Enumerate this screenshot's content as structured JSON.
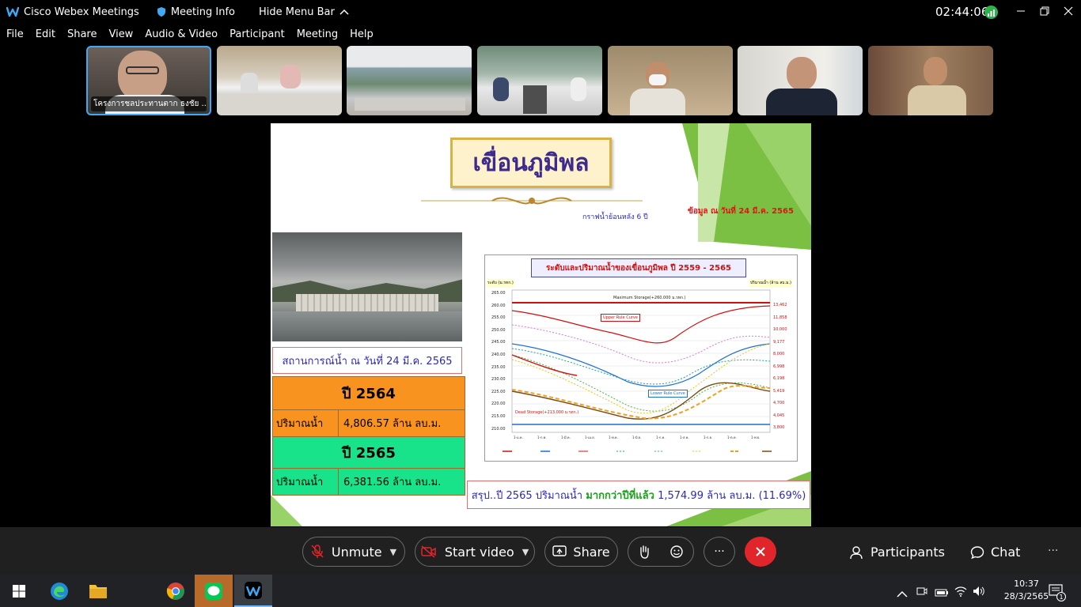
{
  "titlebar": {
    "app_name": "Cisco Webex Meetings",
    "meeting_info": "Meeting Info",
    "hide_menu": "Hide Menu Bar",
    "timer": "02:44:06"
  },
  "menu": [
    "File",
    "Edit",
    "Share",
    "View",
    "Audio & Video",
    "Participant",
    "Meeting",
    "Help"
  ],
  "participants_strip": {
    "active_name": "โครงการชลประทานตาก ธงชัย ..."
  },
  "slide": {
    "title": "เขื่อนภูมิพล",
    "subtitle_left": "กราฟน้ำย้อนหลัง 6 ปี",
    "data_date": "ข้อมูล ณ วันที่ 24 มี.ค. 2565",
    "situation_label": "สถานการณ์น้ำ ณ วันที่ 24 มี.ค. 2565",
    "table": {
      "year1": "ปี 2564",
      "year1_label": "ปริมาณน้ำ",
      "year1_value": "4,806.57 ล้าน ลบ.ม.",
      "year2": "ปี 2565",
      "year2_label": "ปริมาณน้ำ",
      "year2_value": "6,381.56 ล้าน ลบ.ม."
    },
    "chart": {
      "title": "ระดับและปริมาณน้ำของเขื่อนภูมิพล ปี 2559 - 2565",
      "left_unit": "ระดับ (ม.รทก.)",
      "right_unit": "ปริมาณน้ำ (ล้าน ลบ.ม.)",
      "max_label": "Maximum Storage(+260.000 ม.รทก.)",
      "upper_rule": "Upper Rule Curve",
      "lower_rule": "Lower Rule Curve",
      "dead_storage": "Dead Storage(+213.000 ม.รทก.)",
      "left_ticks": [
        "265.00",
        "260.00",
        "255.00",
        "250.00",
        "245.00",
        "240.00",
        "235.00",
        "230.00",
        "225.00",
        "220.00",
        "215.00",
        "210.00"
      ],
      "right_ticks": [
        "13,462",
        "11,858",
        "10,000",
        "9,177",
        "8,000",
        "6,998",
        "6,198",
        "5,419",
        "4,700",
        "4,045",
        "3,800"
      ]
    },
    "summary_prefix": "สรุป..ปี 2565 ปริมาณน้ำ ",
    "summary_highlight": "มากกว่าปีที่แล้ว",
    "summary_suffix": " 1,574.99 ล้าน ลบ.ม. (11.69%)"
  },
  "controls": {
    "unmute": "Unmute",
    "start_video": "Start video",
    "share": "Share",
    "more": "···",
    "participants": "Participants",
    "chat": "Chat",
    "overflow": "···"
  },
  "taskbar": {
    "time": "10:37",
    "date": "28/3/2565",
    "notif_count": "1"
  },
  "colors": {
    "leave_red": "#e0262b",
    "slide_green": "#7bc043",
    "orange_row": "#f7931e",
    "green_row": "#19e38a"
  }
}
